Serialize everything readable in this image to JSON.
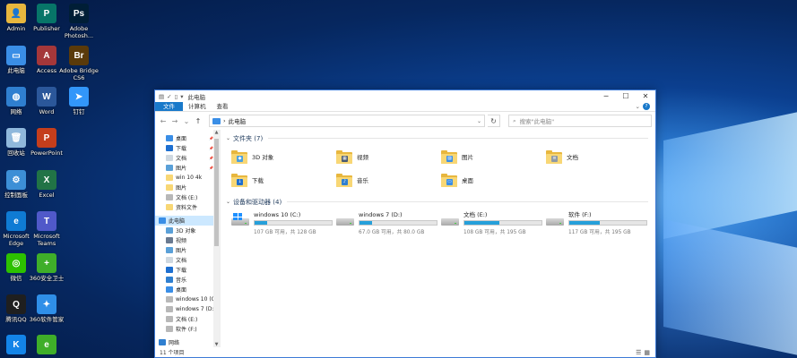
{
  "desktop": {
    "icons": [
      {
        "label": "Admin",
        "icon": "user-folder-icon",
        "color": "#e8b73e",
        "glyph": "👤"
      },
      {
        "label": "Publisher",
        "icon": "publisher-icon",
        "color": "#077568",
        "glyph": "P"
      },
      {
        "label": "Adobe Photosh...",
        "icon": "photoshop-icon",
        "color": "#001e36",
        "glyph": "Ps"
      },
      {
        "label": "此电脑",
        "icon": "this-pc-icon",
        "color": "#3a8ee6",
        "glyph": "▭"
      },
      {
        "label": "Access",
        "icon": "access-icon",
        "color": "#a4373a",
        "glyph": "A"
      },
      {
        "label": "Adobe Bridge CS6",
        "icon": "bridge-icon",
        "color": "#5a3a0a",
        "glyph": "Br"
      },
      {
        "label": "网络",
        "icon": "network-icon",
        "color": "#2f7fd0",
        "glyph": "◍"
      },
      {
        "label": "Word",
        "icon": "word-icon",
        "color": "#2b579a",
        "glyph": "W"
      },
      {
        "label": "钉钉",
        "icon": "dingtalk-icon",
        "color": "#3296fa",
        "glyph": "➤"
      },
      {
        "label": "回收站",
        "icon": "recycle-bin-icon",
        "color": "#8fb8dc",
        "glyph": "🗑"
      },
      {
        "label": "PowerPoint",
        "icon": "powerpoint-icon",
        "color": "#c43e1c",
        "glyph": "P"
      },
      {
        "label": "控制面板",
        "icon": "control-panel-icon",
        "color": "#3c8fd6",
        "glyph": "⚙"
      },
      {
        "label": "Excel",
        "icon": "excel-icon",
        "color": "#217346",
        "glyph": "X"
      },
      {
        "label": "Microsoft Edge",
        "icon": "edge-icon",
        "color": "#0f7bd4",
        "glyph": "e"
      },
      {
        "label": "Microsoft Teams",
        "icon": "teams-icon",
        "color": "#5059c9",
        "glyph": "T"
      },
      {
        "label": "微信",
        "icon": "wechat-icon",
        "color": "#2dc100",
        "glyph": "◎"
      },
      {
        "label": "360安全卫士",
        "icon": "360-security-icon",
        "color": "#3fae29",
        "glyph": "+"
      },
      {
        "label": "腾讯QQ",
        "icon": "qq-icon",
        "color": "#1f1f1f",
        "glyph": "Q"
      },
      {
        "label": "360软件管家",
        "icon": "360-software-icon",
        "color": "#2f8fe8",
        "glyph": "✦"
      },
      {
        "label": "",
        "icon": "kugou-icon",
        "color": "#1384e8",
        "glyph": "K"
      },
      {
        "label": "",
        "icon": "360-browser-icon",
        "color": "#3fae29",
        "glyph": "e"
      }
    ]
  },
  "window": {
    "title": "此电脑",
    "quick_access": [
      "▤",
      "✓",
      "▯",
      "▾"
    ],
    "controls": {
      "minimize": "─",
      "maximize": "☐",
      "close": "✕"
    },
    "ribbon": {
      "tabs": [
        "文件",
        "计算机",
        "查看"
      ],
      "expand": "⌄",
      "help": "?"
    },
    "nav": {
      "back": "←",
      "forward": "→",
      "recent": "⌄",
      "up": "↑"
    },
    "address": {
      "crumbs": [
        "›",
        "此电脑"
      ],
      "dropdown": "⌄",
      "refresh": "↻"
    },
    "search": {
      "placeholder": "搜索\"此电脑\"",
      "icon": "⌕"
    },
    "sidebar": {
      "quick": [
        {
          "label": "桌面",
          "icon": "desktop-icon",
          "color": "#3a8ee6",
          "pinned": true
        },
        {
          "label": "下载",
          "icon": "download-icon",
          "color": "#1e6fd0",
          "pinned": true
        },
        {
          "label": "文档",
          "icon": "documents-icon",
          "color": "#cfd8e0",
          "pinned": true
        },
        {
          "label": "图片",
          "icon": "pictures-icon",
          "color": "#5aa0d8",
          "pinned": true
        },
        {
          "label": "win 10 4k",
          "icon": "folder-icon",
          "color": "#f8d775",
          "pinned": false
        },
        {
          "label": "图片",
          "icon": "folder-icon",
          "color": "#f8d775",
          "pinned": false
        },
        {
          "label": "文档 (E:)",
          "icon": "drive-icon",
          "color": "#b8b8b8",
          "pinned": false
        },
        {
          "label": "资料文件",
          "icon": "folder-icon",
          "color": "#f8d775",
          "pinned": false
        }
      ],
      "this_pc_label": "此电脑",
      "pc_items": [
        {
          "label": "3D 对象",
          "icon": "3d-objects-icon",
          "color": "#5aa0d8"
        },
        {
          "label": "视频",
          "icon": "videos-icon",
          "color": "#6a7a90"
        },
        {
          "label": "图片",
          "icon": "pictures-icon",
          "color": "#5aa0d8"
        },
        {
          "label": "文档",
          "icon": "documents-icon",
          "color": "#cfd8e0"
        },
        {
          "label": "下载",
          "icon": "download-icon",
          "color": "#1e6fd0"
        },
        {
          "label": "音乐",
          "icon": "music-icon",
          "color": "#2f7fd0"
        },
        {
          "label": "桌面",
          "icon": "desktop-icon",
          "color": "#3a8ee6"
        },
        {
          "label": "windows 10 (C:)",
          "icon": "drive-icon",
          "color": "#b8b8b8"
        },
        {
          "label": "windows 7 (D:)",
          "icon": "drive-icon",
          "color": "#b8b8b8"
        },
        {
          "label": "文档 (E:)",
          "icon": "drive-icon",
          "color": "#b8b8b8"
        },
        {
          "label": "软件 (F:)",
          "icon": "drive-icon",
          "color": "#b8b8b8"
        }
      ],
      "network_label": "网络"
    },
    "folders_header": "文件夹 (7)",
    "folders": [
      {
        "label": "3D 对象",
        "icon": "3d-objects-icon",
        "emblem": "◆",
        "emblem_color": "#4aa0e0"
      },
      {
        "label": "视频",
        "icon": "videos-icon",
        "emblem": "▦",
        "emblem_color": "#4a5a70"
      },
      {
        "label": "图片",
        "icon": "pictures-icon",
        "emblem": "▨",
        "emblem_color": "#3a8ee6"
      },
      {
        "label": "文档",
        "icon": "documents-icon",
        "emblem": "≡",
        "emblem_color": "#8f9aa5"
      },
      {
        "label": "下载",
        "icon": "download-icon",
        "emblem": "↓",
        "emblem_color": "#1e6fd0"
      },
      {
        "label": "音乐",
        "icon": "music-icon",
        "emblem": "♪",
        "emblem_color": "#2f7fd0"
      },
      {
        "label": "桌面",
        "icon": "desktop-icon",
        "emblem": "▭",
        "emblem_color": "#3a8ee6"
      }
    ],
    "drives_header": "设备和驱动器 (4)",
    "drives": [
      {
        "name": "windows 10 (C:)",
        "free": "107 GB 可用，共 128 GB",
        "used_fraction": 0.16,
        "system": true
      },
      {
        "name": "windows 7 (D:)",
        "free": "67.0 GB 可用，共 80.0 GB",
        "used_fraction": 0.16,
        "system": false
      },
      {
        "name": "文档 (E:)",
        "free": "108 GB 可用，共 195 GB",
        "used_fraction": 0.45,
        "system": false
      },
      {
        "name": "软件 (F:)",
        "free": "117 GB 可用，共 195 GB",
        "used_fraction": 0.4,
        "system": false
      }
    ],
    "status": {
      "count": "11 个项目",
      "view_details": "☰",
      "view_tiles": "▦"
    }
  }
}
